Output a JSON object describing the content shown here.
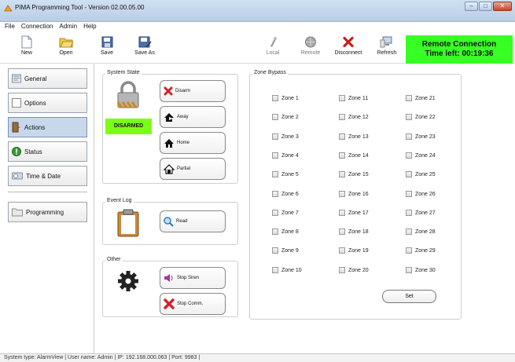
{
  "window": {
    "title": "PIMA Programming Tool - Version 02.00.05.00",
    "buttons": {
      "minimize": "–",
      "maximize": "□",
      "close": "✕"
    }
  },
  "menu": [
    "File",
    "Connection",
    "Admin",
    "Help"
  ],
  "toolbar": {
    "new": "New",
    "open": "Open",
    "save": "Save",
    "save_as": "Save As",
    "local": "Local",
    "remote": "Remote",
    "disconnect": "Disconnect",
    "refresh": "Refresh"
  },
  "remote_connection": {
    "title": "Remote Connection",
    "time_left": "Time left: 00:19:36"
  },
  "sidebar": {
    "items": [
      {
        "label": "General",
        "icon": "general-icon"
      },
      {
        "label": "Options",
        "icon": "options-icon"
      },
      {
        "label": "Actions",
        "icon": "actions-icon",
        "active": true
      },
      {
        "label": "Status",
        "icon": "status-icon"
      },
      {
        "label": "Time & Date",
        "icon": "time-date-icon"
      },
      {
        "label": "Programming",
        "icon": "programming-icon"
      }
    ]
  },
  "system_state": {
    "title": "System State",
    "status": "DISARMED",
    "buttons": {
      "disarm": "Disarm",
      "away": "Away",
      "home": "Home",
      "partial": "Partial"
    }
  },
  "event_log": {
    "title": "Event Log",
    "read": "Read"
  },
  "other": {
    "title": "Other",
    "stop_siren": "Stop Siren",
    "stop_comm": "Stop Comm."
  },
  "zone_bypass": {
    "title": "Zone Bypass",
    "zones": [
      "Zone 1",
      "Zone 2",
      "Zone 3",
      "Zone 4",
      "Zone 5",
      "Zone 6",
      "Zone 7",
      "Zone 8",
      "Zone 9",
      "Zone 10",
      "Zone 11",
      "Zone 12",
      "Zone 13",
      "Zone 14",
      "Zone 15",
      "Zone 16",
      "Zone 17",
      "Zone 18",
      "Zone 19",
      "Zone 20",
      "Zone 21",
      "Zone 22",
      "Zone 23",
      "Zone 24",
      "Zone 25",
      "Zone 26",
      "Zone 27",
      "Zone 28",
      "Zone 29",
      "Zone 30"
    ],
    "set": "Set"
  },
  "status_bar": "System type:  AlarmView  |  User name:  Admin  |  IP:  192.168.000.063  |  Port:  9983  |",
  "colors": {
    "remote_bg": "#38ff24",
    "disarmed_bg": "#7cff17",
    "active_nav": "#c8d7ea"
  }
}
